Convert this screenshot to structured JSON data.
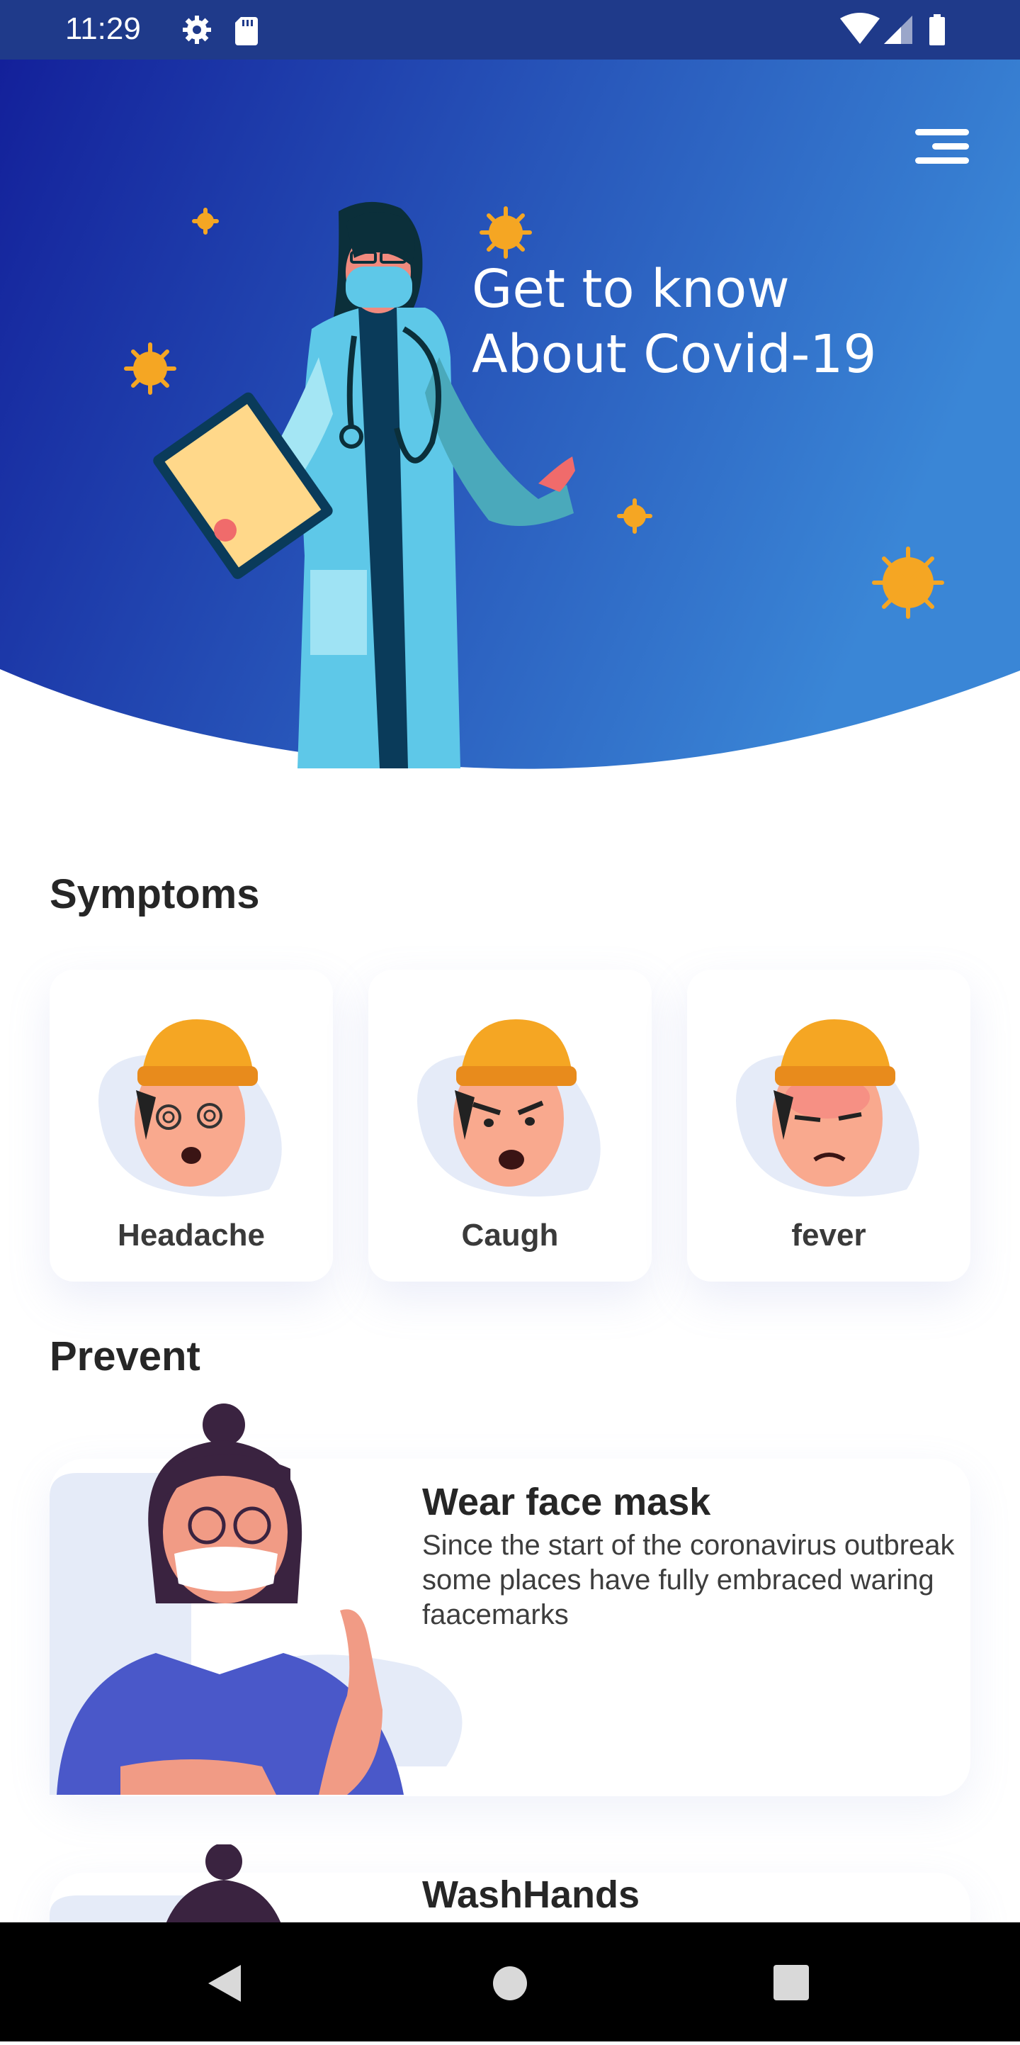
{
  "status_bar": {
    "time": "11:29",
    "icons_left": [
      "gear-icon",
      "sd-card-icon"
    ],
    "icons_right": [
      "wifi-icon",
      "signal-icon",
      "battery-icon"
    ]
  },
  "hero": {
    "title_line1": "Get to know",
    "title_line2": "About Covid-19",
    "gradient": [
      "#13209a",
      "#3a86d6"
    ],
    "menu_icon": "hamburger-menu-icon"
  },
  "symptoms": {
    "heading": "Symptoms",
    "items": [
      {
        "label": "Headache"
      },
      {
        "label": "Caugh"
      },
      {
        "label": "fever"
      }
    ]
  },
  "prevent": {
    "heading": "Prevent",
    "items": [
      {
        "title": "Wear face mask",
        "description": "Since the start of the coronavirus outbreak some places have fully embraced waring faacemarks"
      },
      {
        "title": "WashHands",
        "description": ""
      }
    ]
  },
  "nav": {
    "icons": [
      "back-icon",
      "home-icon",
      "recents-icon"
    ]
  },
  "colors": {
    "accent_orange": "#f5a623",
    "heading_text": "#262626",
    "card_bg": "#ffffff"
  }
}
